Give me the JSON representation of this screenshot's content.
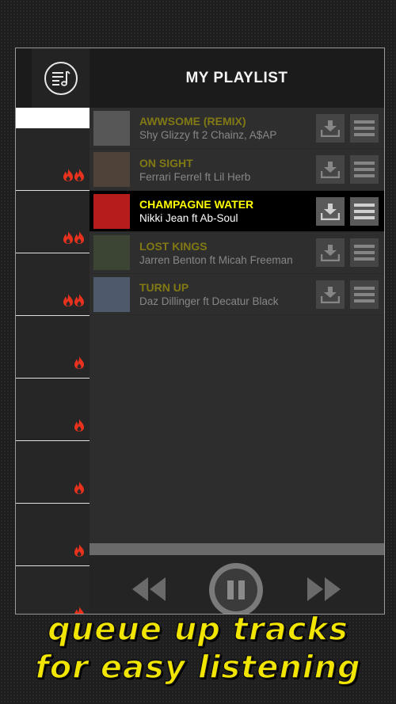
{
  "header": {
    "title": "MY PLAYLIST",
    "queue_icon": "music-queue-icon"
  },
  "sidebar": {
    "items": [
      {
        "flames": 2
      },
      {
        "flames": 2
      },
      {
        "flames": 2
      },
      {
        "flames": 1
      },
      {
        "flames": 1
      },
      {
        "flames": 1
      },
      {
        "flames": 1
      },
      {
        "flames": 1
      }
    ]
  },
  "tracks": [
    {
      "title": "AWWSOME (REMIX)",
      "artist": "Shy Glizzy ft 2 Chainz, A$AP",
      "state": "dim",
      "art": "#7a7a7a"
    },
    {
      "title": "ON SIGHT",
      "artist": "Ferrari Ferrel ft Lil Herb",
      "state": "dim",
      "art": "#6b5444"
    },
    {
      "title": "CHAMPAGNE WATER",
      "artist": "Nikki Jean ft Ab-Soul",
      "state": "active",
      "art": "#b51d1d"
    },
    {
      "title": "LOST KINGS",
      "artist": "Jarren Benton ft Micah Freeman",
      "state": "dim",
      "art": "#4a5a3a"
    },
    {
      "title": "TURN UP",
      "artist": "Daz Dillinger ft Decatur Black",
      "state": "dim",
      "art": "#6a7ea0"
    }
  ],
  "player": {
    "rewind_icon": "rewind-icon",
    "pause_icon": "pause-icon",
    "forward_icon": "fast-forward-icon"
  },
  "promo": {
    "line1": "queue up tracks",
    "line2": "for easy listening"
  },
  "colors": {
    "accent": "#ffff00",
    "title_dim": "#c6b700",
    "flame": "#e8321e"
  }
}
